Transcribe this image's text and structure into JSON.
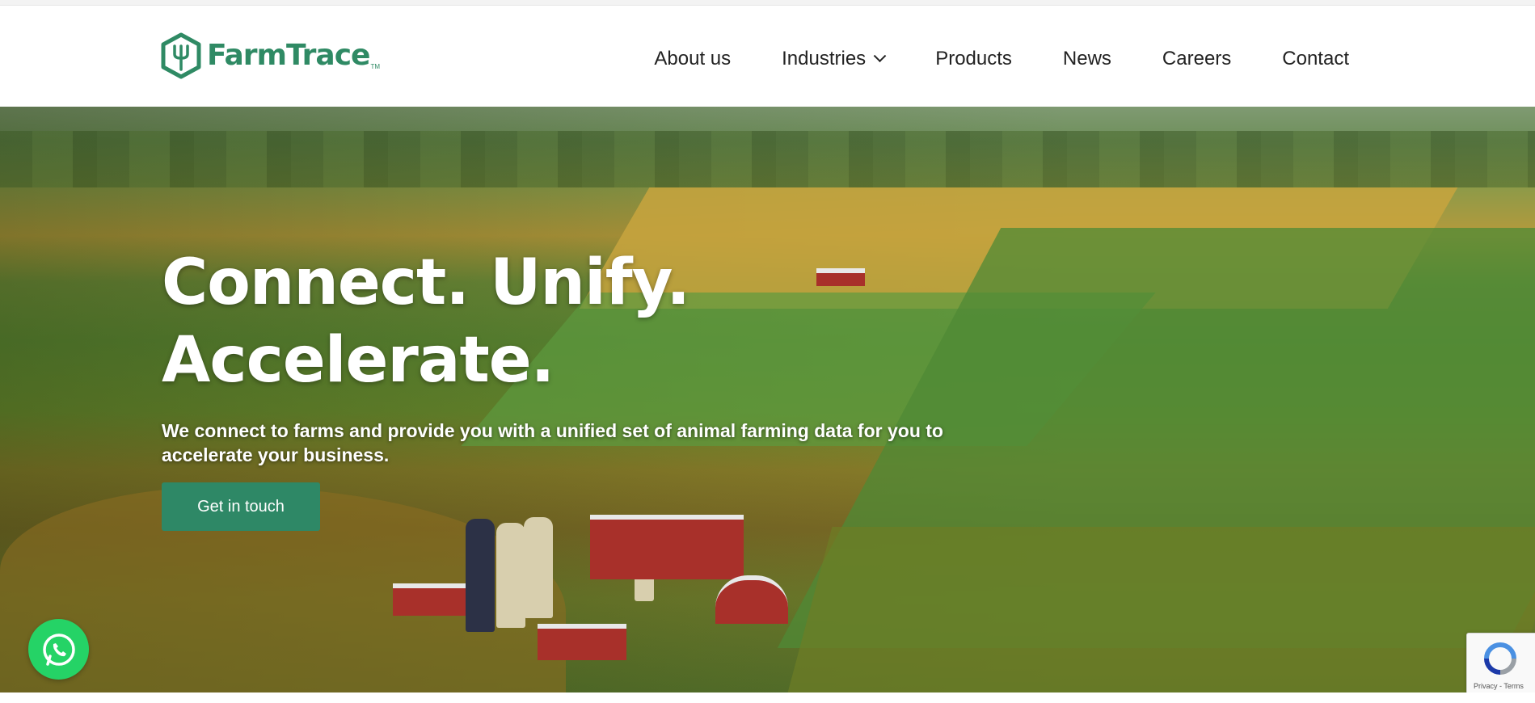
{
  "brand": {
    "name": "FarmTrace",
    "trademark": "TM",
    "color": "#2f8a64"
  },
  "nav": {
    "items": [
      {
        "label": "About us",
        "icon": null
      },
      {
        "label": "Industries",
        "icon": "chevron-down-icon"
      },
      {
        "label": "Products",
        "icon": null
      },
      {
        "label": "News",
        "icon": null
      },
      {
        "label": "Careers",
        "icon": null
      },
      {
        "label": "Contact",
        "icon": null
      }
    ]
  },
  "hero": {
    "title_line1": "Connect. Unify.",
    "title_line2": "Accelerate.",
    "subtitle": "We connect to farms and provide you with a unified set of animal farming data for you to accelerate your business.",
    "cta_label": "Get in touch",
    "cta_color": "#2e8866",
    "background": "aerial farm landscape"
  },
  "widgets": {
    "whatsapp_icon": "whatsapp-icon",
    "whatsapp_color": "#25d366",
    "recaptcha_links": "Privacy - Terms"
  }
}
